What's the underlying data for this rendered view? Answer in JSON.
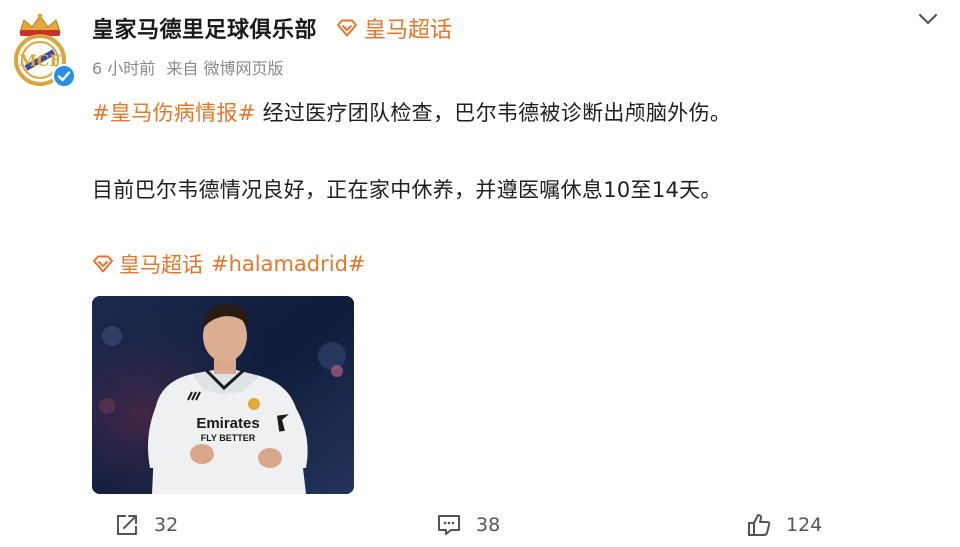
{
  "header": {
    "account_name": "皇家马德里足球俱乐部",
    "topic_tag": "皇马超话",
    "time_ago": "6 小时前",
    "source": "来自 微博网页版"
  },
  "post": {
    "hashtag": "#皇马伤病情报#",
    "line1_text": " 经过医疗团队检查，巴尔韦德被诊断出颅脑外伤。",
    "line2_text": "目前巴尔韦德情况良好，正在家中休养，并遵医嘱休息10至14天。",
    "topic_link": "皇马超话",
    "hashtag2": "#halamadrid#",
    "shirt_sponsor": "Emirates",
    "shirt_sponsor_sub": "FLY BETTER"
  },
  "actions": {
    "share_count": "32",
    "comment_count": "38",
    "like_count": "124"
  },
  "colors": {
    "accent": "#e8762a",
    "verified": "#2a8ee8",
    "meta_text": "#8a8a8a"
  },
  "icons": {
    "more": "chevron-down-icon",
    "topic": "diamond-icon",
    "share": "share-icon",
    "comment": "comment-icon",
    "like": "thumbs-up-icon",
    "verified": "verified-badge-icon"
  }
}
